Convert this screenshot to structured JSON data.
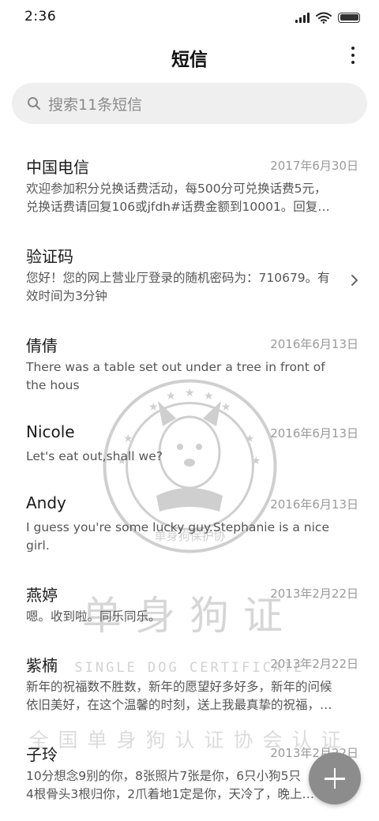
{
  "status_bar": {
    "time": "2:36",
    "icons": [
      "signal-icon",
      "wifi-icon",
      "battery-icon"
    ]
  },
  "header": {
    "title": "短信",
    "more_icon": "more-vertical-icon"
  },
  "search": {
    "placeholder": "搜索11条短信",
    "icon": "search-icon"
  },
  "messages": [
    {
      "sender": "中国电信",
      "date": "2017年6月30日",
      "preview": [
        "欢迎参加积分兑换话费活动，每500分可兑换话费5元，",
        "兑换话费请回复106或jfdh#话费金额到10001。回复…"
      ]
    },
    {
      "sender": "验证码",
      "date": "",
      "preview": [
        "您好！您的网上营业厅登录的随机密码为：710679。有",
        "效时间为3分钟"
      ],
      "trailing_icon": "chevron-right-icon"
    },
    {
      "sender": "倩倩",
      "date": "2016年6月13日",
      "preview": [
        "There was a table set out under a tree in front of",
        "the hous"
      ]
    },
    {
      "sender": "Nicole",
      "date": "2016年6月13日",
      "preview": [
        "Let's eat out,shall we?"
      ]
    },
    {
      "sender": "Andy",
      "date": "2016年6月13日",
      "preview": [
        "I guess you're some lucky guy.Stephanie is a nice",
        "girl."
      ]
    },
    {
      "sender": "燕婷",
      "date": "2013年2月22日",
      "preview": [
        "嗯。收到啦。同乐同乐。"
      ]
    },
    {
      "sender": "紫楠",
      "date": "2013年2月22日",
      "preview": [
        "新年的祝福数不胜数，新年的愿望好多好多，新年的问候",
        "依旧美好，在这个温馨的时刻，送上我最真挚的祝福，…"
      ]
    },
    {
      "sender": "子玲",
      "date": "2013年2月22日",
      "preview": [
        "10分想念9别的你，8张照片7张是你，6只小狗5只",
        "4根骨头3根归你，2爪着地1定是你，天冷了，晚上…"
      ]
    }
  ],
  "watermark": {
    "seal_text": "单身狗保护协",
    "title": "单身狗证",
    "subtitle": "SINGLE DOG CERTIFICATE",
    "association": "全国单身狗认证协会认证",
    "icon": "dog-seal-icon"
  },
  "fab": {
    "icon": "plus-icon"
  }
}
